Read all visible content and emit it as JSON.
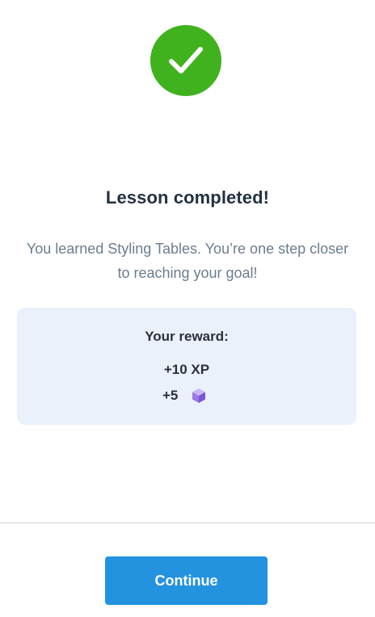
{
  "status": {
    "icon": "checkmark-icon",
    "color": "#3fb21e"
  },
  "title": "Lesson completed!",
  "subtitle": "You learned Styling Tables. You’re one step closer to reaching your goal!",
  "reward": {
    "heading": "Your reward:",
    "xp": "+10 XP",
    "gems": "+5",
    "gem_icon": "purple-cube-icon"
  },
  "footer": {
    "continue_label": "Continue",
    "button_color": "#2393df"
  }
}
